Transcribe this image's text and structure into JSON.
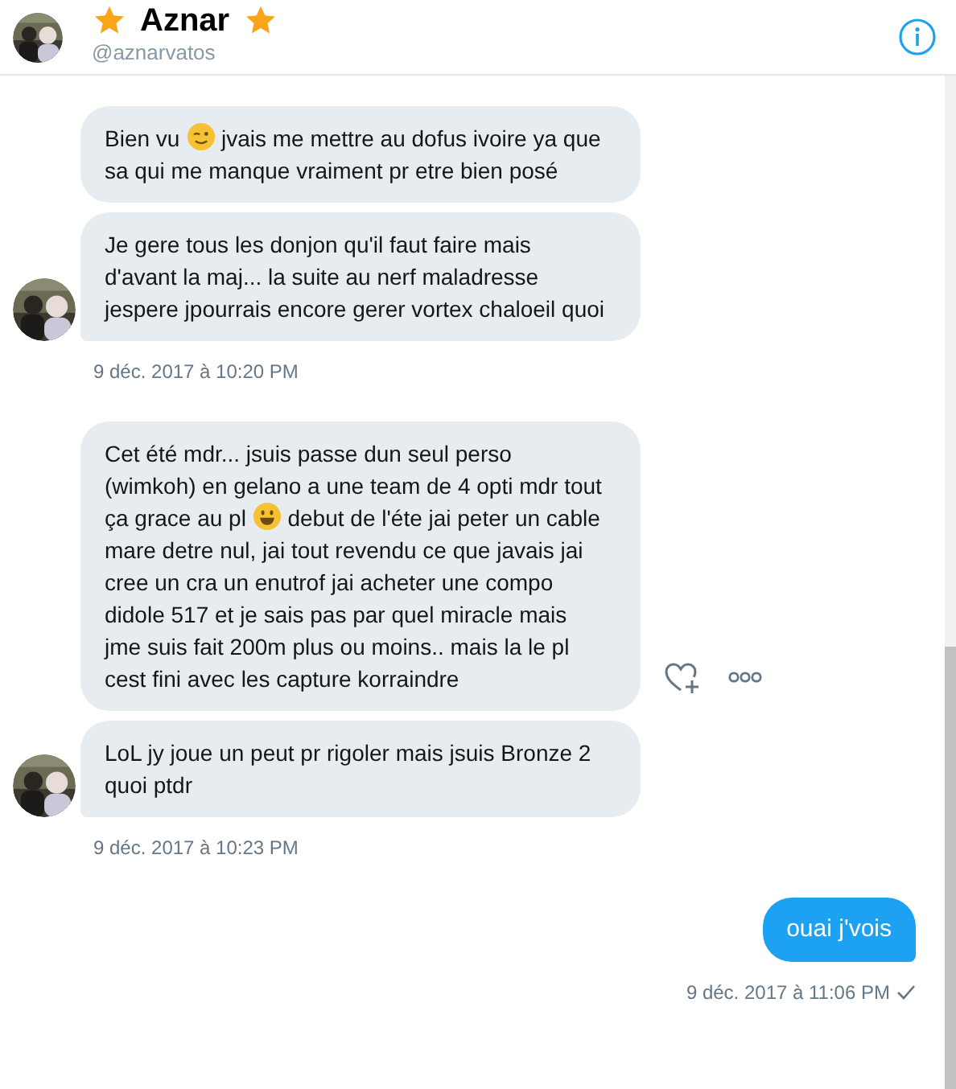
{
  "header": {
    "name": "Aznar",
    "handle": "@aznarvatos"
  },
  "groups": [
    {
      "kind": "received",
      "timestamp": "9 déc. 2017 à 10:20 PM",
      "messages": [
        {
          "parts": [
            {
              "kind": "text",
              "text": "Bien vu "
            },
            {
              "kind": "wink"
            },
            {
              "kind": "text",
              "text": " jvais me mettre au dofus ivoire ya que sa qui me manque vraiment pr etre bien posé"
            }
          ],
          "actions_visible": false
        },
        {
          "parts": [
            {
              "kind": "text",
              "text": "Je gere tous les donjon qu'il faut faire mais d'avant la maj... la suite au nerf maladresse jespere jpourrais encore gerer vortex chaloeil quoi"
            }
          ],
          "actions_visible": false
        }
      ]
    },
    {
      "kind": "received",
      "timestamp": "9 déc. 2017 à 10:23 PM",
      "messages": [
        {
          "parts": [
            {
              "kind": "text",
              "text": "Cet été mdr... jsuis passe dun seul perso (wimkoh) en gelano a une team de 4 opti mdr tout ça grace au pl "
            },
            {
              "kind": "grin"
            },
            {
              "kind": "text",
              "text": " debut de l'éte jai peter un cable mare detre nul, jai tout revendu ce que javais jai cree un cra un enutrof jai acheter une compo didole 517 et je sais pas par quel miracle mais jme suis fait 200m plus ou moins.. mais la le pl cest fini avec les capture korraindre"
            }
          ],
          "actions_visible": true
        },
        {
          "parts": [
            {
              "kind": "text",
              "text": "LoL jy joue un peut pr rigoler mais jsuis Bronze 2 quoi ptdr"
            }
          ],
          "actions_visible": false
        }
      ]
    },
    {
      "kind": "sent",
      "timestamp": "9 déc. 2017 à 11:06 PM",
      "seen": true,
      "messages": [
        {
          "parts": [
            {
              "kind": "text",
              "text": "ouai j'vois"
            }
          ],
          "actions_visible": false
        }
      ]
    }
  ]
}
